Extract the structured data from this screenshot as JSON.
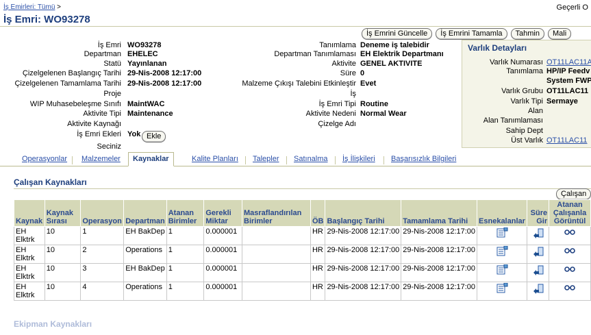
{
  "breadcrumb": {
    "link": "İş Emirleri: Tümü",
    "sep": ">"
  },
  "header_right": "Geçerli O",
  "page_title": "İş Emri: WO93278",
  "buttons": {
    "update": "İş Emrini Güncelle",
    "complete": "İş Emrini Tamamla",
    "estimate": "Tahmin",
    "cost": "Mali"
  },
  "left_fields": [
    {
      "label": "İş Emri",
      "value": "WO93278"
    },
    {
      "label": "Departman",
      "value": "EHELEC"
    },
    {
      "label": "Statü",
      "value": "Yayınlanan"
    },
    {
      "label": "Çizelgelenen Başlangıç Tarihi",
      "value": "29-Nis-2008 12:17:00"
    },
    {
      "label": "Çizelgelenen Tamamlama Tarihi",
      "value": "29-Nis-2008 12:17:00"
    },
    {
      "label": "Proje",
      "value": ""
    },
    {
      "label": "WIP Muhasebeleşme Sınıfı",
      "value": "MaintWAC"
    },
    {
      "label": "Aktivite Tipi",
      "value": "Maintenance"
    },
    {
      "label": "Aktivite Kaynağı",
      "value": ""
    },
    {
      "label": "İş Emri Ekleri",
      "value": "Yok"
    }
  ],
  "attach_button": "Ekle",
  "seciniz": "Seciniz",
  "mid_fields": [
    {
      "label": "Tanımlama",
      "value": "Deneme iş talebidir"
    },
    {
      "label": "Departman Tanımlaması",
      "value": "EH Elektrik Departmanı"
    },
    {
      "label": "Aktivite",
      "value": "GENEL AKTIVITE"
    },
    {
      "label": "Süre",
      "value": "0"
    },
    {
      "label": "Malzeme Çıkışı Talebini Etkinleştir",
      "value": "Evet"
    },
    {
      "label": "İş",
      "value": ""
    },
    {
      "label": "İş Emri Tipi",
      "value": "Routine"
    },
    {
      "label": "Aktivite Nedeni",
      "value": "Normal Wear"
    },
    {
      "label": "Çizelge Adı",
      "value": ""
    }
  ],
  "asset": {
    "title": "Varlık Detayları",
    "fields": [
      {
        "label": "Varlık Numarası",
        "value": "OT11LAC11A",
        "link": true
      },
      {
        "label": "Tanımlama",
        "value": "HP/IP Feedv",
        "link": false
      },
      {
        "label": "",
        "value": "System FWP",
        "link": false
      },
      {
        "label": "Varlık Grubu",
        "value": "OT11LAC11",
        "link": false
      },
      {
        "label": "Varlık Tipi",
        "value": "Sermaye",
        "link": false
      },
      {
        "label": "Alan",
        "value": "",
        "link": false
      },
      {
        "label": "Alan Tanımlaması",
        "value": "",
        "link": false
      },
      {
        "label": "Sahip Dept",
        "value": "",
        "link": false
      },
      {
        "label": "Üst Varlık",
        "value": "OT11LAC11",
        "link": true
      }
    ]
  },
  "tabs": [
    "Operasyonlar",
    "Malzemeler",
    "Kaynaklar",
    "Kalite Planları",
    "Talepler",
    "Satınalma",
    "İş İlişkileri",
    "Başarısızlık Bilgileri"
  ],
  "active_tab": "Kaynaklar",
  "section_title": "Çalışan Kaynakları",
  "calisan_button": "Çalışan",
  "table": {
    "headers": [
      "Kaynak",
      "Kaynak Sırası",
      "Operasyon",
      "Departman",
      "Atanan Birimler",
      "Gerekli Miktar",
      "Masraflandırılan Birimler",
      "ÖB",
      "Başlangıç Tarihi",
      "Tamamlama Tarihi",
      "Esnekalanlar",
      "Süre Gir",
      "Atanan Çalışanla Görüntül"
    ],
    "rows": [
      [
        "EH Elktrk",
        "10",
        "1",
        "EH BakDep",
        "1",
        "0.000001",
        "",
        "HR",
        "29-Nis-2008 12:17:00",
        "29-Nis-2008 12:17:00"
      ],
      [
        "EH Elktrk",
        "10",
        "2",
        "Operations",
        "1",
        "0.000001",
        "",
        "HR",
        "29-Nis-2008 12:17:00",
        "29-Nis-2008 12:17:00"
      ],
      [
        "EH Elktrk",
        "10",
        "3",
        "EH BakDep",
        "1",
        "0.000001",
        "",
        "HR",
        "29-Nis-2008 12:17:00",
        "29-Nis-2008 12:17:00"
      ],
      [
        "EH Elktrk",
        "10",
        "4",
        "Operations",
        "1",
        "0.000001",
        "",
        "HR",
        "29-Nis-2008 12:17:00",
        "29-Nis-2008 12:17:00"
      ]
    ]
  },
  "icons": {
    "flex": "flex-fields-icon",
    "time": "enter-time-icon",
    "view": "view-assigned-employees-icon"
  },
  "colors": {
    "header_bg": "#d5d8b7",
    "title": "#1e3f7d",
    "link": "#2a4fa8"
  },
  "next_section": "Ekipman Kaynakları"
}
